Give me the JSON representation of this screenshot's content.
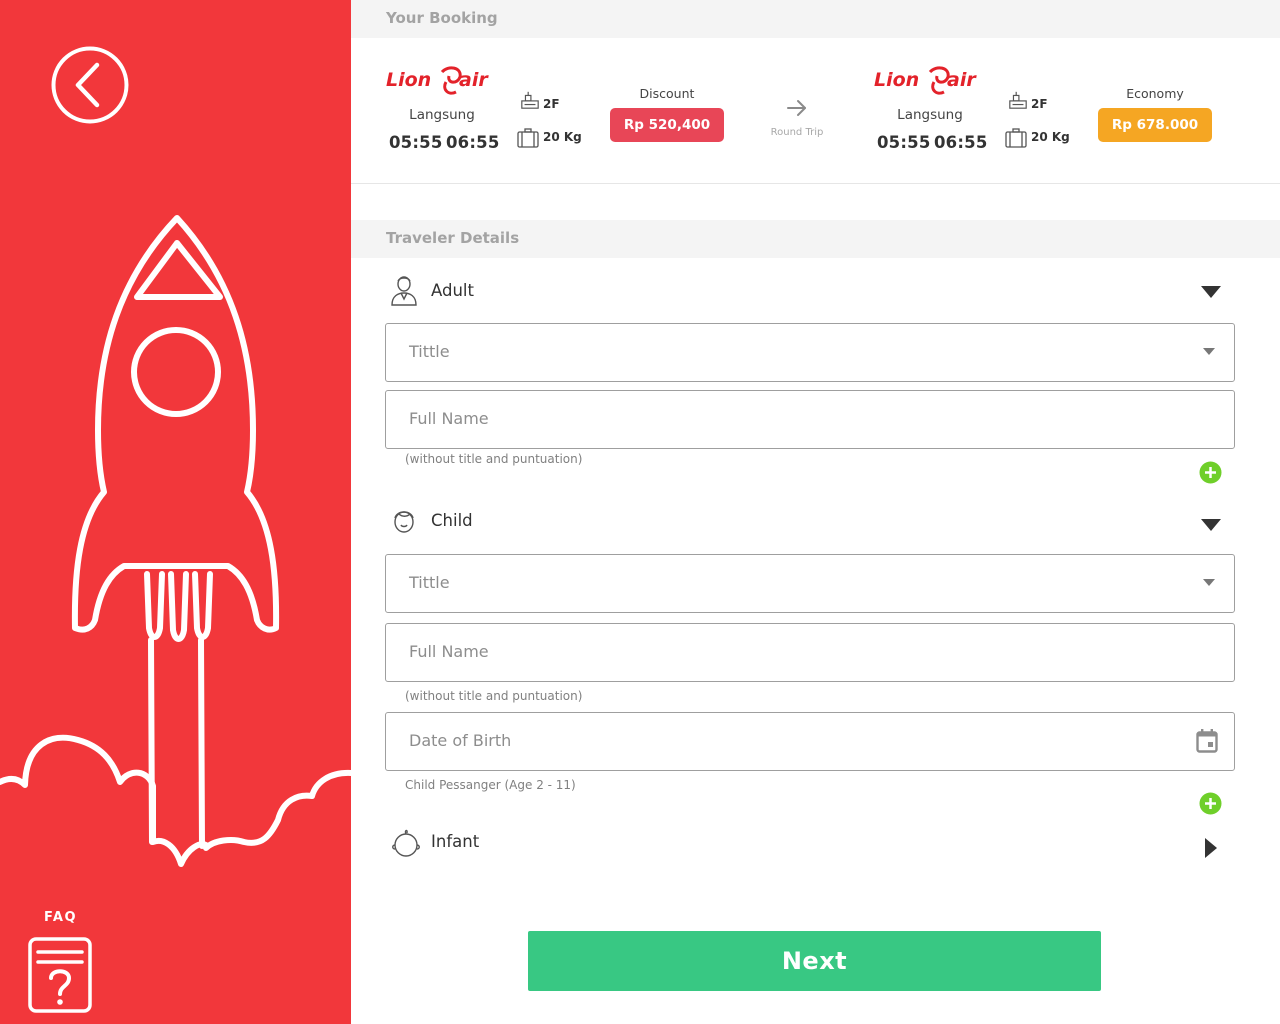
{
  "faq": {
    "label": "FAQ"
  },
  "booking": {
    "section_title": "Your Booking",
    "trip_type": "Round Trip",
    "airline_logo_text": "Lion air",
    "outbound": {
      "route_type": "Langsung",
      "depart": "05:55",
      "arrive": "06:55",
      "terminal": "2F",
      "baggage": "20 Kg",
      "price_label": "Discount",
      "price": "Rp 520,400",
      "price_color": "#e84657"
    },
    "return": {
      "route_type": "Langsung",
      "depart": "05:55",
      "arrive": "06:55",
      "terminal": "2F",
      "baggage": "20 Kg",
      "price_label": "Economy",
      "price": "Rp 678.000",
      "price_color": "#f5a623"
    }
  },
  "traveler": {
    "section_title": "Traveler Details",
    "adult": {
      "label": "Adult",
      "title_placeholder": "Tittle",
      "name_placeholder": "Full Name",
      "name_hint": "(without title and puntuation)"
    },
    "child": {
      "label": "Child",
      "title_placeholder": "Tittle",
      "name_placeholder": "Full Name",
      "name_hint": "(without title and puntuation)",
      "dob_placeholder": "Date of Birth",
      "dob_hint": "Child Pessanger (Age 2 - 11)"
    },
    "infant": {
      "label": "Infant"
    }
  },
  "actions": {
    "next_label": "Next"
  },
  "colors": {
    "sidebar": "#f2373b",
    "discount_badge": "#e84657",
    "economy_badge": "#f5a623",
    "next_button": "#38c883",
    "add_button": "#6fcf2a"
  },
  "icons": {
    "back": "chevron-left-circle-icon",
    "faq": "help-document-icon",
    "adult": "person-icon",
    "child": "child-face-icon",
    "infant": "infant-face-icon",
    "terminal": "terminal-building-icon",
    "baggage": "luggage-icon",
    "trip": "arrow-right-icon",
    "add": "plus-circle-icon",
    "calendar": "calendar-icon"
  }
}
